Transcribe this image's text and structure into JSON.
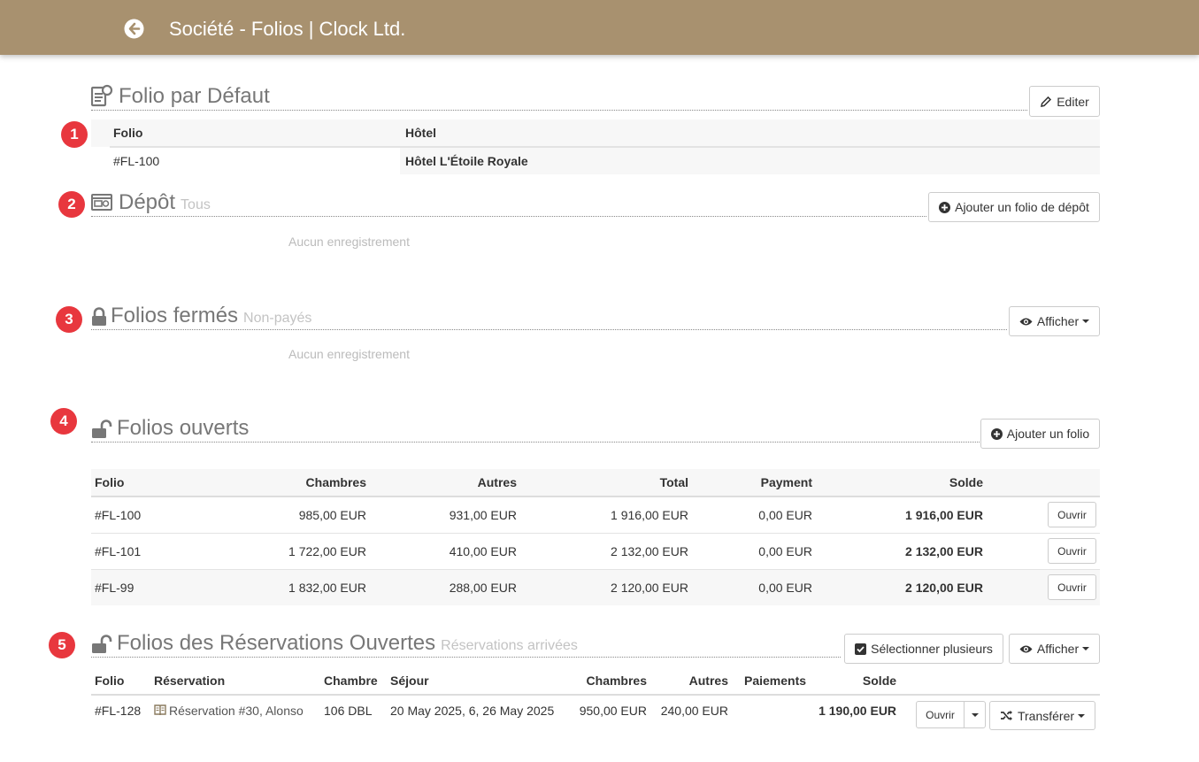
{
  "header": {
    "title": "Société - Folios | Clock Ltd."
  },
  "badges": [
    "1",
    "2",
    "3",
    "4",
    "5"
  ],
  "default_folio": {
    "title": "Folio par Défaut",
    "edit_label": "Editer",
    "columns": [
      "Folio",
      "Hôtel"
    ],
    "row": {
      "folio": "#FL-100",
      "hotel": "Hôtel L'Étoile Royale"
    }
  },
  "deposit": {
    "title": "Dépôt",
    "subtitle": "Tous",
    "add_label": "Ajouter un folio de dépôt",
    "empty": "Aucun enregistrement"
  },
  "closed": {
    "title": "Folios fermés",
    "subtitle": "Non-payés",
    "show_label": "Afficher",
    "empty": "Aucun enregistrement"
  },
  "open": {
    "title": "Folios ouverts",
    "add_label": "Ajouter un folio",
    "columns": [
      "Folio",
      "Chambres",
      "Autres",
      "Total",
      "Payment",
      "Solde"
    ],
    "open_label": "Ouvrir",
    "rows": [
      {
        "folio": "#FL-100",
        "rooms": "985,00 EUR",
        "others": "931,00 EUR",
        "total": "1 916,00 EUR",
        "payment": "0,00 EUR",
        "balance": "1 916,00 EUR"
      },
      {
        "folio": "#FL-101",
        "rooms": "1 722,00 EUR",
        "others": "410,00 EUR",
        "total": "2 132,00 EUR",
        "payment": "0,00 EUR",
        "balance": "2 132,00 EUR"
      },
      {
        "folio": "#FL-99",
        "rooms": "1 832,00 EUR",
        "others": "288,00 EUR",
        "total": "2 120,00 EUR",
        "payment": "0,00 EUR",
        "balance": "2 120,00 EUR"
      }
    ]
  },
  "reservations": {
    "title": "Folios des Réservations Ouvertes",
    "subtitle": "Réservations arrivées",
    "select_label": "Sélectionner plusieurs",
    "show_label": "Afficher",
    "columns": [
      "Folio",
      "Réservation",
      "Chambre",
      "Séjour",
      "Chambres",
      "Autres",
      "Paiements",
      "Solde"
    ],
    "open_label": "Ouvrir",
    "transfer_label": "Transférer",
    "rows": [
      {
        "folio": "#FL-128",
        "reservation": "Réservation #30, Alonso",
        "room": "106 DBL",
        "stay": "20 May 2025, 6, 26 May 2025",
        "rooms": "950,00 EUR",
        "others": "240,00 EUR",
        "payments": "",
        "balance": "1 190,00 EUR"
      }
    ]
  }
}
